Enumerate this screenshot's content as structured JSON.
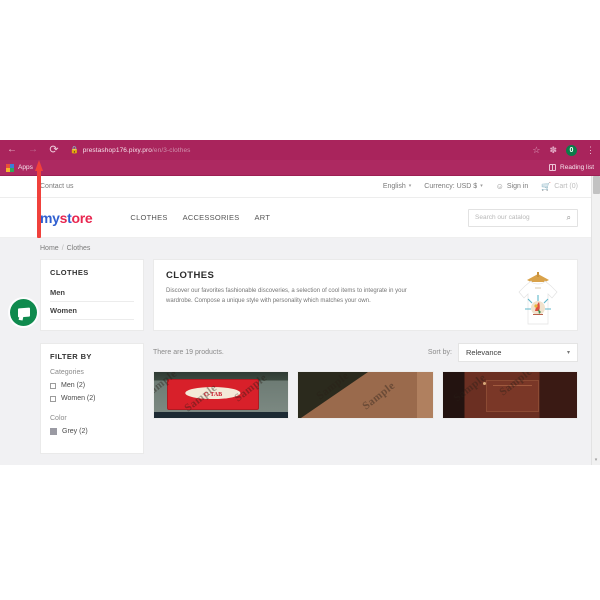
{
  "browser": {
    "nav": {
      "back_icon": "arrow-left-icon",
      "forward_icon": "arrow-right-icon",
      "reload_icon": "reload-icon",
      "back_glyph": "←",
      "forward_glyph": "→",
      "reload_glyph": "⟳"
    },
    "address_bar": {
      "lock_glyph": "🔒",
      "url_host": "prestashop176.pixy.pro",
      "url_path": "/en/3-clothes",
      "full_url": "prestashop176.pixy.pro/en/3-clothes"
    },
    "toolbar_right": {
      "bookmark_star_glyph": "☆",
      "extension_glyph": "✽",
      "profile_badge": "0",
      "menu_glyph": "⋮"
    },
    "bookmarks_bar": {
      "apps_label": "Apps",
      "reading_list_label": "Reading list"
    }
  },
  "site": {
    "topbar": {
      "contact_label": "Contact us",
      "language_label": "English",
      "currency_label": "Currency: USD $",
      "signin_label": "Sign in",
      "cart_label": "Cart (0)",
      "caret_glyph": "▾"
    },
    "header": {
      "logo_part1": "my",
      "logo_part2": "s",
      "logo_part3": "t",
      "logo_part4": "ore",
      "nav": [
        {
          "label": "CLOTHES"
        },
        {
          "label": "ACCESSORIES"
        },
        {
          "label": "ART"
        }
      ],
      "search_placeholder": "Search our catalog",
      "search_value": "",
      "search_icon_glyph": "⌕"
    },
    "breadcrumb": {
      "home_label": "Home",
      "separator": "/",
      "current_label": "Clothes"
    },
    "sidebar": {
      "category_block": {
        "title": "CLOTHES",
        "links": [
          {
            "label": "Men"
          },
          {
            "label": "Women"
          }
        ]
      },
      "filter_block": {
        "title": "FILTER BY",
        "facets": [
          {
            "name": "Categories",
            "type": "checkbox",
            "options": [
              {
                "label": "Men (2)"
              },
              {
                "label": "Women (2)"
              }
            ]
          },
          {
            "name": "Color",
            "type": "swatch",
            "options": [
              {
                "label": "Grey (2)",
                "color": "#9a9aa3"
              }
            ]
          }
        ]
      }
    },
    "category_banner": {
      "title": "CLOTHES",
      "description": "Discover our favorites fashionable discoveries, a selection of cool items to integrate in your wardrobe. Compose a unique style with personality which matches your own.",
      "image_name": "tshirt-on-hanger-image"
    },
    "listing": {
      "product_count_text": "There are 19 products.",
      "sort_label": "Sort by:",
      "sort_value": "Relevance",
      "sort_caret": "▾",
      "products": [
        {
          "name": "product-thumb-1",
          "watermark": "Sample"
        },
        {
          "name": "product-thumb-2",
          "watermark": "Sample"
        },
        {
          "name": "product-thumb-3",
          "watermark": "Sample"
        }
      ]
    },
    "scrollbar": {
      "down_arrow": "▾"
    }
  },
  "annotations": {
    "arrow": {
      "name": "red-arrow-pointing-at-reload",
      "color": "#f0413c"
    },
    "badge": {
      "name": "green-chat-badge",
      "color": "#0f8a4e"
    }
  }
}
